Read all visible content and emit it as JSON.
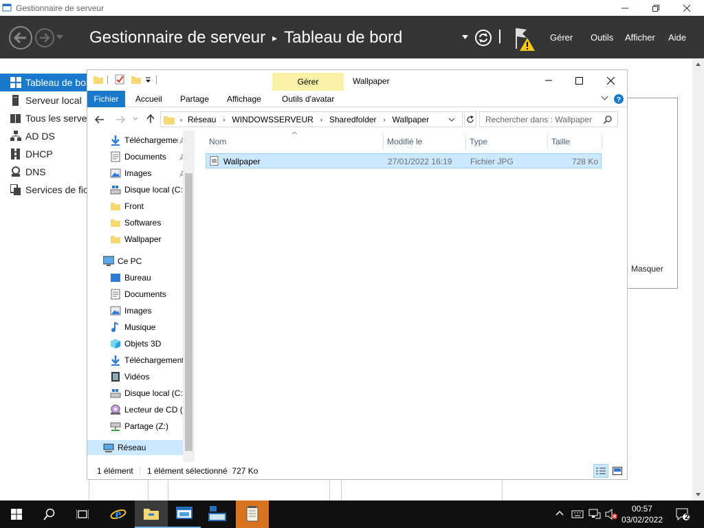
{
  "server_manager": {
    "window_title": "Gestionnaire de serveur",
    "breadcrumb_app": "Gestionnaire de serveur",
    "breadcrumb_sep": "▸",
    "breadcrumb_page": "Tableau de bord",
    "menu": [
      "Gérer",
      "Outils",
      "Afficher",
      "Aide"
    ],
    "sidebar": [
      {
        "label": "Tableau de bord",
        "icon": "dashboard-icon"
      },
      {
        "label": "Serveur local",
        "icon": "server-icon"
      },
      {
        "label": "Tous les serveurs",
        "icon": "servers-icon"
      },
      {
        "label": "AD DS",
        "icon": "ad-ds-icon"
      },
      {
        "label": "DHCP",
        "icon": "dhcp-icon"
      },
      {
        "label": "DNS",
        "icon": "dns-icon"
      },
      {
        "label": "Services de fichiers",
        "icon": "file-services-icon"
      }
    ],
    "tile_hide": "Masquer"
  },
  "explorer": {
    "title": "Wallpaper",
    "contextual_tab_group": "Gérer",
    "ribbon_tabs": [
      "Fichier",
      "Accueil",
      "Partage",
      "Affichage",
      "Outils d'avatar"
    ],
    "address_parts": [
      "Réseau",
      "WINDOWSSERVEUR",
      "Sharedfolder",
      "Wallpaper"
    ],
    "search_placeholder": "Rechercher dans : Wallpaper",
    "nav_quick_access": [
      {
        "label": "Téléchargements",
        "icon": "download-icon",
        "pinned": true
      },
      {
        "label": "Documents",
        "icon": "documents-icon",
        "pinned": true
      },
      {
        "label": "Images",
        "icon": "images-icon",
        "pinned": true
      },
      {
        "label": "Disque local (C:)",
        "icon": "drive-icon",
        "pinned": false
      },
      {
        "label": "Front",
        "icon": "folder-icon",
        "pinned": false
      },
      {
        "label": "Softwares",
        "icon": "folder-icon",
        "pinned": false
      },
      {
        "label": "Wallpaper",
        "icon": "folder-icon",
        "pinned": false
      }
    ],
    "nav_this_pc": {
      "label": "Ce PC",
      "icon": "this-pc-icon"
    },
    "nav_pc_items": [
      {
        "label": "Bureau",
        "icon": "desktop-icon"
      },
      {
        "label": "Documents",
        "icon": "documents-icon"
      },
      {
        "label": "Images",
        "icon": "images-icon"
      },
      {
        "label": "Musique",
        "icon": "music-icon"
      },
      {
        "label": "Objets 3D",
        "icon": "objects-3d-icon"
      },
      {
        "label": "Téléchargements",
        "icon": "download-icon"
      },
      {
        "label": "Vidéos",
        "icon": "videos-icon"
      },
      {
        "label": "Disque local (C:)",
        "icon": "drive-icon"
      },
      {
        "label": "Lecteur de CD (D:)",
        "icon": "cd-drive-icon"
      },
      {
        "label": "Partage (Z:)",
        "icon": "network-drive-icon"
      }
    ],
    "nav_network": {
      "label": "Réseau",
      "icon": "network-icon"
    },
    "columns": [
      "Nom",
      "Modifié le",
      "Type",
      "Taille"
    ],
    "files": [
      {
        "name": "Wallpaper",
        "modified": "27/01/2022 16:19",
        "type": "Fichier JPG",
        "size": "728 Ko",
        "selected": true
      }
    ],
    "status_count": "1 élément",
    "status_selected": "1 élément sélectionné  727 Ko"
  },
  "taskbar": {
    "time": "00:57",
    "date": "03/02/2022",
    "notification_count": "2"
  },
  "colors": {
    "header_bg": "#353535",
    "selected_sidebar": "#1979ca",
    "file_tab": "#1979ca",
    "manage_tab": "#f9f1a5",
    "selection": "#cce8ff",
    "warning": "#f5c518"
  }
}
